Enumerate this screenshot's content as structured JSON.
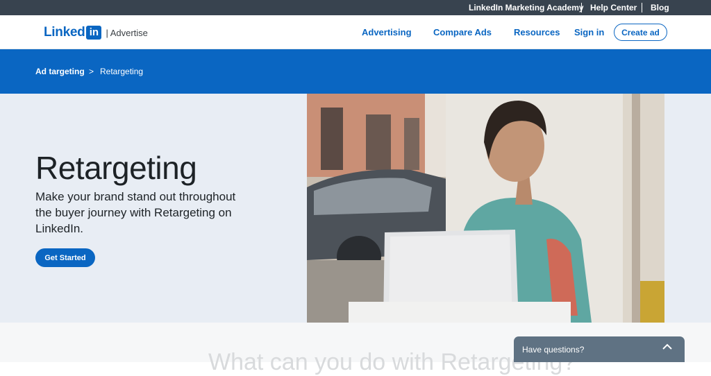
{
  "utility": {
    "links": [
      "LinkedIn Marketing Academy",
      "Help Center",
      "Blog"
    ]
  },
  "header": {
    "logo_word": "Linked",
    "logo_in": "in",
    "logo_sub": "| Advertise",
    "nav": [
      "Advertising",
      "Compare Ads",
      "Resources",
      "Sign in"
    ],
    "create_ad": "Create ad"
  },
  "breadcrumb": {
    "parent": "Ad targeting",
    "separator": ">",
    "current": "Retargeting"
  },
  "hero": {
    "title": "Retargeting",
    "subtitle": "Make your brand stand out throughout the buyer journey with Retargeting on LinkedIn.",
    "cta": "Get Started"
  },
  "lower": {
    "heading": "What can you do with Retargeting?"
  },
  "chat": {
    "label": "Have questions?",
    "icon": "chevron-up-icon"
  },
  "colors": {
    "brand": "#0a66c2",
    "utility_bar": "#38434f",
    "hero_bg": "#e8edf4",
    "chat_bg": "#5f7283"
  }
}
